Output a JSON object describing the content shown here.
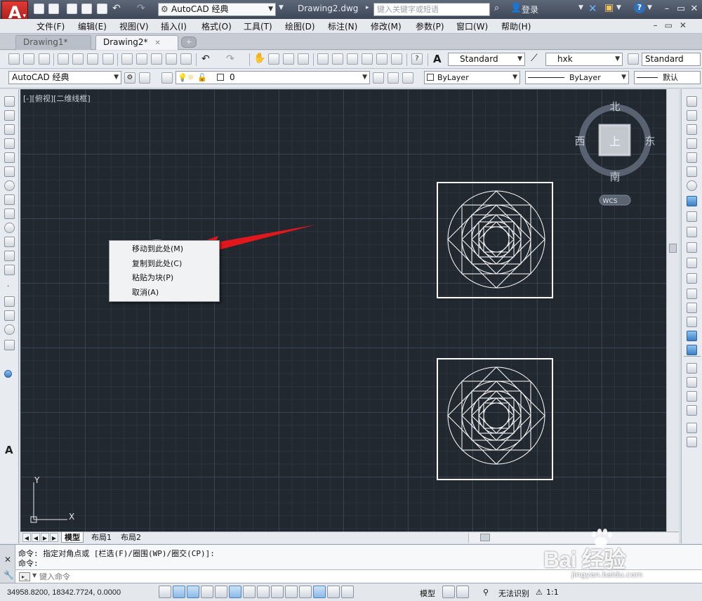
{
  "window": {
    "app_logo": "A",
    "workspace": "AutoCAD 经典",
    "doc_title": "Drawing2.dwg",
    "search_placeholder": "键入关键字或短语",
    "login": "登录"
  },
  "menu": [
    "文件(F)",
    "编辑(E)",
    "视图(V)",
    "插入(I)",
    "格式(O)",
    "工具(T)",
    "绘图(D)",
    "标注(N)",
    "修改(M)",
    "参数(P)",
    "窗口(W)",
    "帮助(H)"
  ],
  "tabs": {
    "doc1": "Drawing1*",
    "doc2": "Drawing2*"
  },
  "toolbar": {
    "text_style": "Standard",
    "dim_style": "hxk",
    "table_style": "Standard",
    "workspace2": "AutoCAD 经典",
    "layer": "0",
    "color": "ByLayer",
    "linetype": "ByLayer",
    "lineweight": "默认"
  },
  "canvas": {
    "viewport_label": "[-][俯视][二维线框]",
    "compass": {
      "north": "北",
      "south": "南",
      "east": "东",
      "west": "西",
      "top": "上"
    },
    "wcs": "WCS",
    "ucs_x": "X",
    "ucs_y": "Y"
  },
  "context_menu": {
    "items": [
      "移动到此处(M)",
      "复制到此处(C)",
      "粘贴为块(P)",
      "取消(A)"
    ]
  },
  "layout_tabs": [
    "模型",
    "布局1",
    "布局2"
  ],
  "command": {
    "line1": "命令: 指定对角点或 [栏选(F)/圈围(WP)/圈交(CP)]:",
    "line2": "命令:",
    "input_placeholder": "键入命令"
  },
  "status": {
    "coords": "34958.8200, 18342.7724, 0.0000",
    "model": "模型",
    "recognize": "无法识别",
    "scale": "1:1"
  },
  "watermark": {
    "main": "Bai 经验",
    "sub": "jingyan.baidu.com"
  },
  "colors": {
    "canvas_bg": "#212830",
    "arrow": "#e0171c",
    "geometry": "#ffffff"
  }
}
